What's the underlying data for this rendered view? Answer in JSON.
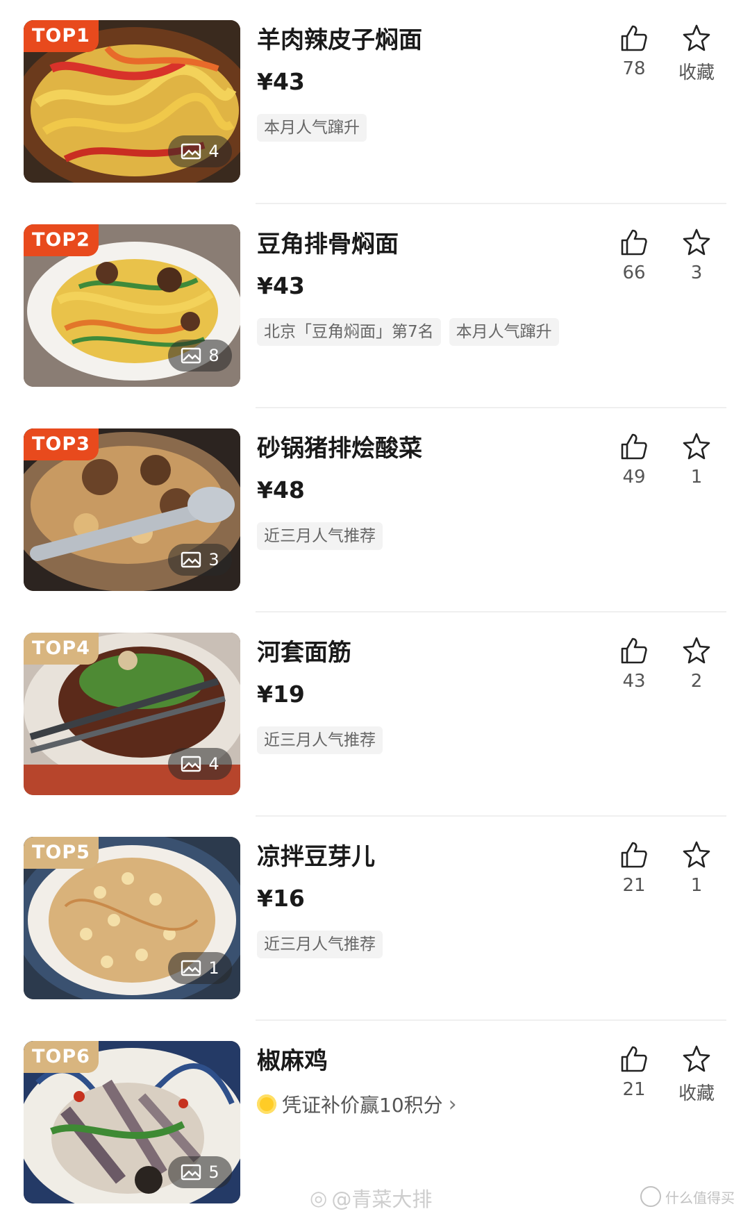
{
  "items": [
    {
      "rank": "TOP1",
      "name": "羊肉辣皮子焖面",
      "price": "¥43",
      "tags": [
        "本月人气蹿升"
      ],
      "photos": "4",
      "likes": "78",
      "fav": "收藏"
    },
    {
      "rank": "TOP2",
      "name": "豆角排骨焖面",
      "price": "¥43",
      "tags": [
        "北京「豆角焖面」第7名",
        "本月人气蹿升"
      ],
      "photos": "8",
      "likes": "66",
      "fav": "3"
    },
    {
      "rank": "TOP3",
      "name": "砂锅猪排烩酸菜",
      "price": "¥48",
      "tags": [
        "近三月人气推荐"
      ],
      "photos": "3",
      "likes": "49",
      "fav": "1"
    },
    {
      "rank": "TOP4",
      "name": "河套面筋",
      "price": "¥19",
      "tags": [
        "近三月人气推荐"
      ],
      "photos": "4",
      "likes": "43",
      "fav": "2"
    },
    {
      "rank": "TOP5",
      "name": "凉拌豆芽儿",
      "price": "¥16",
      "tags": [
        "近三月人气推荐"
      ],
      "photos": "1",
      "likes": "21",
      "fav": "1"
    },
    {
      "rank": "TOP6",
      "name": "椒麻鸡",
      "promo": "凭证补价赢10积分",
      "photos": "5",
      "likes": "21",
      "fav": "收藏"
    }
  ],
  "colors": {
    "rank_hot": "#e84a1d",
    "rank_warm": "#d8b57f",
    "coin": "#ffcc26"
  },
  "icons": {
    "like": "thumbs-up-icon",
    "fav": "star-icon",
    "photos": "image-icon",
    "promo": "coin-icon"
  },
  "watermark": {
    "weibo": "@青菜大排",
    "site": "什么值得买"
  }
}
